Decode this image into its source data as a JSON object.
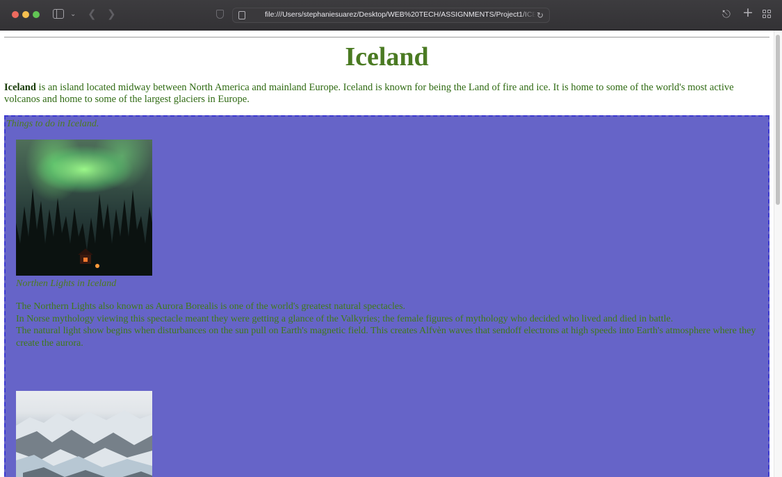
{
  "browser": {
    "url": "file:///Users/stephaniesuarez/Desktop/WEB%20TECH/ASSIGNMENTS/Project1/ICE",
    "traffic_lights": {
      "close": "#ed6a5e",
      "minimize": "#f5bf4f",
      "maximize": "#61c554"
    }
  },
  "page": {
    "title": "Iceland",
    "intro_bold": "Iceland",
    "intro_rest": " is an island located midway between North America and mainland Europe. Iceland is known for being the Land of fire and ice. It is home to some of the world's most active volcanos and home to some of the largest glaciers in Europe.",
    "section": {
      "caption": "Things to do in Iceland.",
      "items": [
        {
          "image_name": "northern-lights-photo",
          "image_caption": "Northen Lights in Iceland",
          "paragraph_lines": [
            "The Northern Lights also known as Aurora Borealis is one of the world's greatest natural spectacles.",
            "In Norse mythology viewing this spectacle meant they were getting a glance of the Valkyries; the female figures of mythology who decided who lived and died in battle.",
            "The natural light show begins when disturbances on the sun pull on Earth's magnetic field. This creates Alfvèn waves that sendoff electrons at high speeds into Earth's atmosphere where they create the aurora."
          ]
        },
        {
          "image_name": "glacier-photo"
        }
      ]
    }
  },
  "colors": {
    "title_green": "#4a7a22",
    "text_green": "#2f6a12",
    "section_background": "#6664c8",
    "section_border": "#3c3ad0"
  }
}
